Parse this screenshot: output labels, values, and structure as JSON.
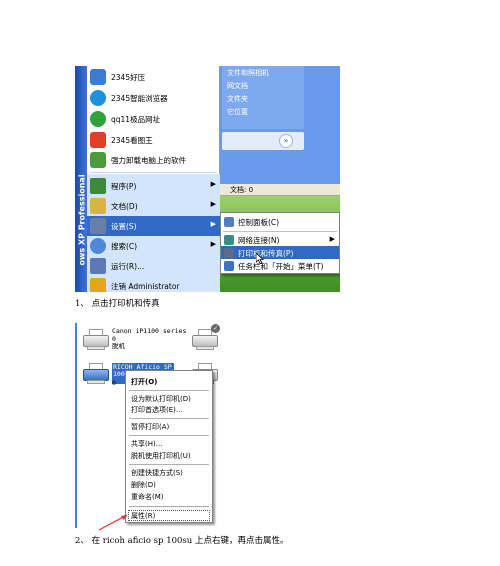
{
  "shot1": {
    "xp_stripe_text": "ows XP Professional",
    "pinned_items": [
      {
        "label": "2345好压",
        "icon": "archive-icon",
        "color": "#3a7bd5"
      },
      {
        "label": "2345智能浏览器",
        "icon": "browser-icon",
        "color": "#1f8fe0"
      },
      {
        "label": "qq11极品网址",
        "icon": "globe-icon",
        "color": "#2fa33a"
      },
      {
        "label": "2345看图王",
        "icon": "picture-viewer-icon",
        "color": "#e0402a"
      },
      {
        "label": "强力卸载电脑上的软件",
        "icon": "uninstall-icon",
        "color": "#4d9a3c"
      }
    ],
    "menu_items": [
      {
        "label": "程序(P)",
        "icon": "programs-icon",
        "color": "#3d8a3a",
        "has_submenu": true
      },
      {
        "label": "文档(D)",
        "icon": "documents-icon",
        "color": "#d9b440",
        "has_submenu": true
      },
      {
        "label": "设置(S)",
        "icon": "settings-icon",
        "color": "#6a7fa8",
        "has_submenu": true,
        "highlighted": true
      },
      {
        "label": "搜索(C)",
        "icon": "search-icon",
        "color": "#4e88d8",
        "has_submenu": true
      },
      {
        "label": "运行(R)...",
        "icon": "run-icon",
        "color": "#5c78b8",
        "has_submenu": false
      },
      {
        "label": "注销 Administrator",
        "icon": "logoff-icon",
        "color": "#e3a51c",
        "has_submenu": false
      }
    ],
    "settings_submenu": [
      {
        "label": "控制面板(C)",
        "icon": "control-panel-icon",
        "color": "#4f7fc0",
        "has_submenu": false
      },
      {
        "label": "网络连接(N)",
        "icon": "network-connections-icon",
        "color": "#3a8a8a",
        "has_submenu": true
      },
      {
        "label": "打印机和传真(P)",
        "icon": "printer-fax-icon",
        "color": "#5a6c8a",
        "has_submenu": false,
        "highlighted": true
      },
      {
        "label": "任务栏和「开始」菜单(T)",
        "icon": "taskbar-icon",
        "color": "#3b73c8",
        "has_submenu": false
      }
    ],
    "panel_links": [
      "文件和照相机",
      "网文档",
      "文件夹",
      "它位置"
    ],
    "doc_bar_text": "文档: 0",
    "colors": {
      "highlight": "#316ac5",
      "menu_column": "#d3e5fa",
      "xp_blue": "#3b6fd4"
    }
  },
  "caption1": "1、 点击打印机和传真",
  "shot2": {
    "printers": [
      {
        "name": "Canon iP1100 series",
        "docs": "0",
        "status": "脱机"
      },
      {
        "name": "RICOH Aficio SP 100SU DDST",
        "docs": "0"
      }
    ],
    "check_badge": "✓",
    "context_menu": [
      [
        "打开(O)"
      ],
      [
        "设为默认打印机(D)",
        "打印首选项(E)..."
      ],
      [
        "暂停打印(A)"
      ],
      [
        "共享(H)...",
        "脱机使用打印机(U)"
      ],
      [
        "创建快捷方式(S)",
        "删除(D)",
        "重命名(M)"
      ],
      [
        "属性(R)"
      ]
    ]
  },
  "caption2": "2、 在 ricoh aficio sp 100su 上点右键，再点击属性。",
  "annotation_color": "#d9302a"
}
